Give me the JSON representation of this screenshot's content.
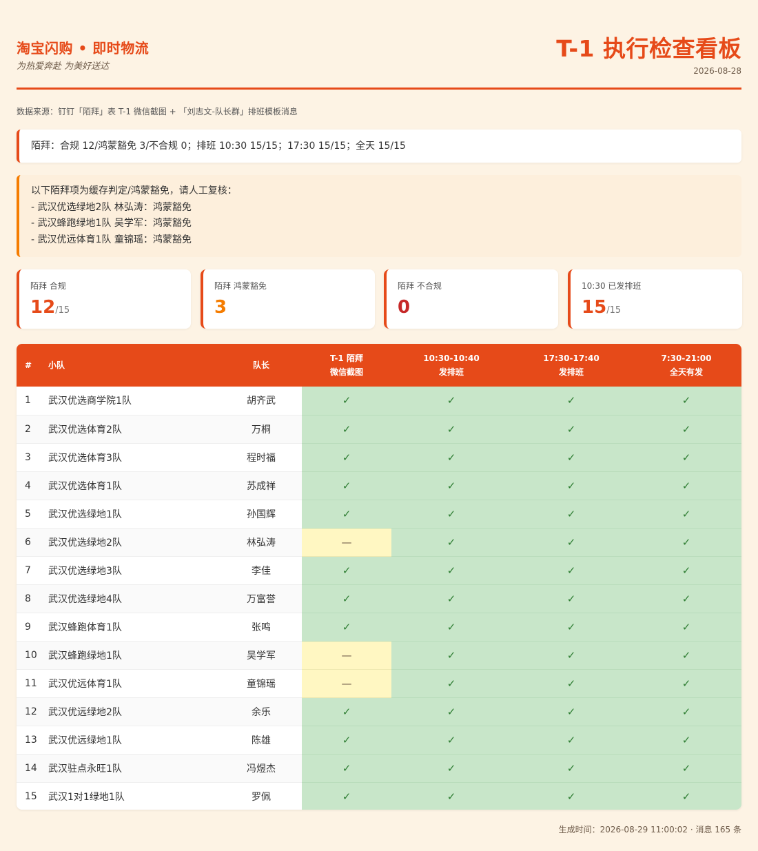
{
  "header": {
    "brand": "淘宝闪购 • 即时物流",
    "slogan": "为热爱奔赴 为美好送达",
    "title": "T-1 执行检查看板",
    "date": "2026-08-28"
  },
  "source": "数据来源：钉钉「陌拜」表 T-1 微信截图 + 「刘志文-队长群」排班模板消息",
  "summary": "陌拜：合规 12/鸿蒙豁免 3/不合规 0；排班 10:30 15/15；17:30 15/15；全天 15/15",
  "notice": {
    "intro": "以下陌拜项为缓存判定/鸿蒙豁免，请人工复核：",
    "items": [
      "- 武汉优选绿地2队 林弘涛：鸿蒙豁免",
      "- 武汉蜂跑绿地1队 吴学军：鸿蒙豁免",
      "- 武汉优远体育1队 童锦瑶：鸿蒙豁免"
    ]
  },
  "stats": [
    {
      "label": "陌拜 合规",
      "value": "12",
      "total": "/15",
      "color": "#e64a19"
    },
    {
      "label": "陌拜 鸿蒙豁免",
      "value": "3",
      "total": "",
      "color": "#f57c00"
    },
    {
      "label": "陌拜 不合规",
      "value": "0",
      "total": "",
      "color": "#c62828"
    },
    {
      "label": "10:30 已发排班",
      "value": "15",
      "total": "/15",
      "color": "#e64a19"
    }
  ],
  "table": {
    "headers": {
      "no": "#",
      "team": "小队",
      "captain": "队长",
      "col1_l1": "T-1 陌拜",
      "col1_l2": "微信截图",
      "col2_l1": "10:30-10:40",
      "col2_l2": "发排班",
      "col3_l1": "17:30-17:40",
      "col3_l2": "发排班",
      "col4_l1": "7:30-21:00",
      "col4_l2": "全天有发"
    },
    "check_mark": "✓",
    "pending_mark": "—",
    "rows": [
      {
        "no": "1",
        "team": "武汉优选商学院1队",
        "captain": "胡齐武",
        "c1": "ok",
        "c2": "ok",
        "c3": "ok",
        "c4": "ok"
      },
      {
        "no": "2",
        "team": "武汉优选体育2队",
        "captain": "万桐",
        "c1": "ok",
        "c2": "ok",
        "c3": "ok",
        "c4": "ok"
      },
      {
        "no": "3",
        "team": "武汉优选体育3队",
        "captain": "程时福",
        "c1": "ok",
        "c2": "ok",
        "c3": "ok",
        "c4": "ok"
      },
      {
        "no": "4",
        "team": "武汉优选体育1队",
        "captain": "苏成祥",
        "c1": "ok",
        "c2": "ok",
        "c3": "ok",
        "c4": "ok"
      },
      {
        "no": "5",
        "team": "武汉优选绿地1队",
        "captain": "孙国辉",
        "c1": "ok",
        "c2": "ok",
        "c3": "ok",
        "c4": "ok"
      },
      {
        "no": "6",
        "team": "武汉优选绿地2队",
        "captain": "林弘涛",
        "c1": "pending",
        "c2": "ok",
        "c3": "ok",
        "c4": "ok"
      },
      {
        "no": "7",
        "team": "武汉优选绿地3队",
        "captain": "李佳",
        "c1": "ok",
        "c2": "ok",
        "c3": "ok",
        "c4": "ok"
      },
      {
        "no": "8",
        "team": "武汉优选绿地4队",
        "captain": "万富誉",
        "c1": "ok",
        "c2": "ok",
        "c3": "ok",
        "c4": "ok"
      },
      {
        "no": "9",
        "team": "武汉蜂跑体育1队",
        "captain": "张鸣",
        "c1": "ok",
        "c2": "ok",
        "c3": "ok",
        "c4": "ok"
      },
      {
        "no": "10",
        "team": "武汉蜂跑绿地1队",
        "captain": "吴学军",
        "c1": "pending",
        "c2": "ok",
        "c3": "ok",
        "c4": "ok"
      },
      {
        "no": "11",
        "team": "武汉优远体育1队",
        "captain": "童锦瑶",
        "c1": "pending",
        "c2": "ok",
        "c3": "ok",
        "c4": "ok"
      },
      {
        "no": "12",
        "team": "武汉优远绿地2队",
        "captain": "余乐",
        "c1": "ok",
        "c2": "ok",
        "c3": "ok",
        "c4": "ok"
      },
      {
        "no": "13",
        "team": "武汉优远绿地1队",
        "captain": "陈雄",
        "c1": "ok",
        "c2": "ok",
        "c3": "ok",
        "c4": "ok"
      },
      {
        "no": "14",
        "team": "武汉驻点永旺1队",
        "captain": "冯煜杰",
        "c1": "ok",
        "c2": "ok",
        "c3": "ok",
        "c4": "ok"
      },
      {
        "no": "15",
        "team": "武汉1对1绿地1队",
        "captain": "罗佩",
        "c1": "ok",
        "c2": "ok",
        "c3": "ok",
        "c4": "ok"
      }
    ]
  },
  "footer": "生成时间：2026-08-29 11:00:02 · 消息 165 条"
}
